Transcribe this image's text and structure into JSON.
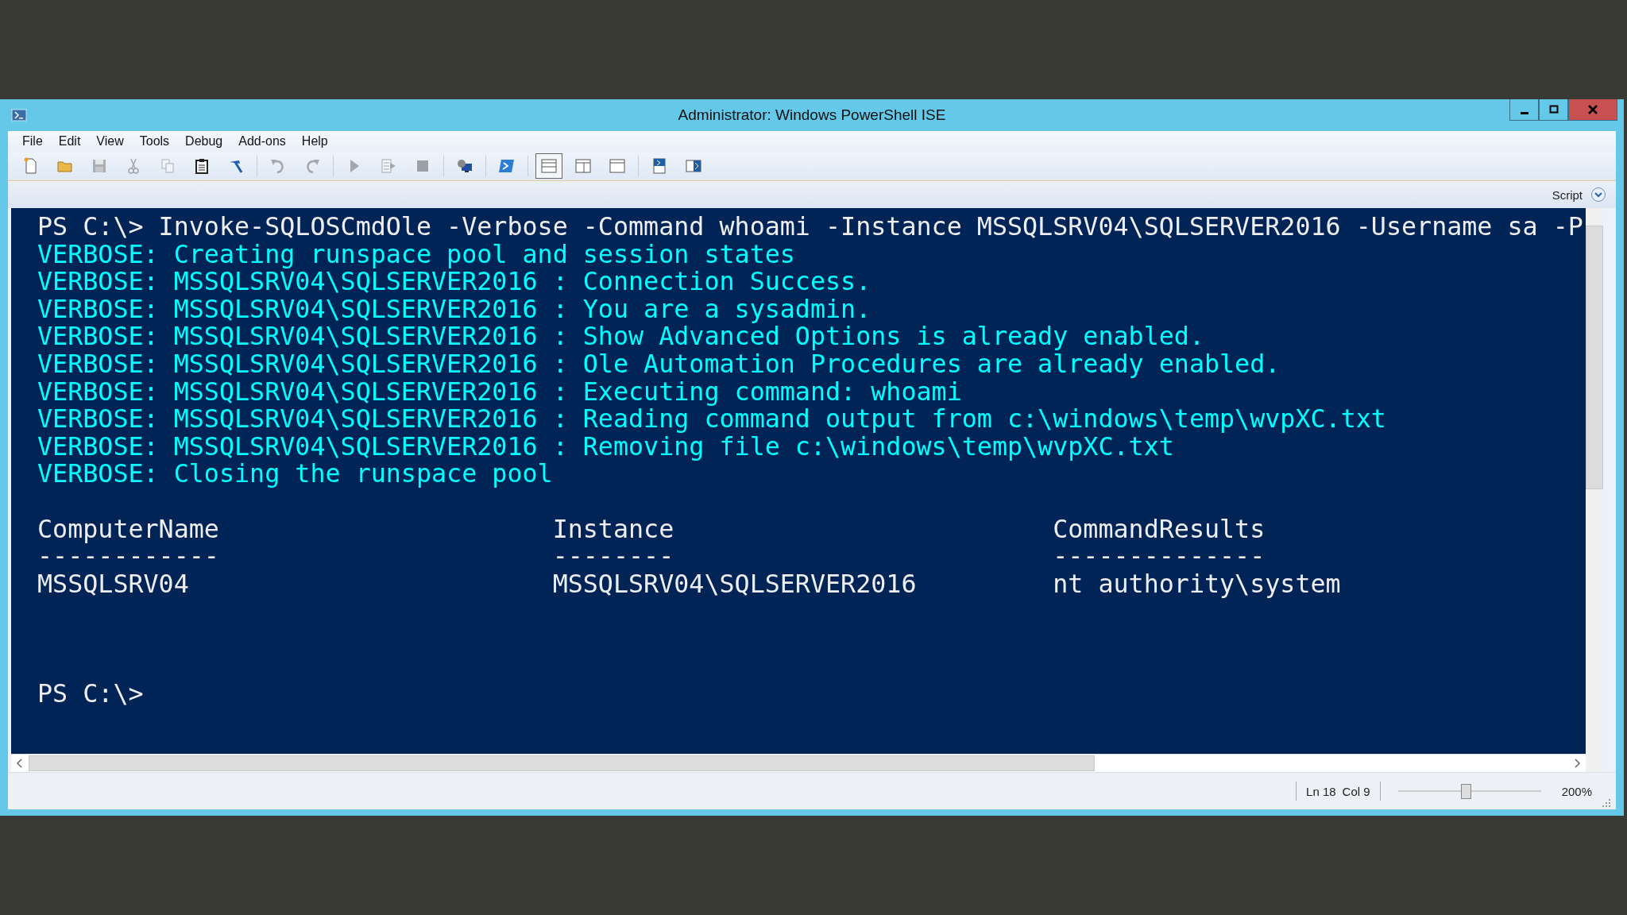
{
  "window": {
    "title": "Administrator: Windows PowerShell ISE"
  },
  "menu": [
    {
      "label": "File"
    },
    {
      "label": "Edit"
    },
    {
      "label": "View"
    },
    {
      "label": "Tools"
    },
    {
      "label": "Debug"
    },
    {
      "label": "Add-ons"
    },
    {
      "label": "Help"
    }
  ],
  "toolbar": [
    {
      "kind": "new",
      "disabled": false
    },
    {
      "kind": "open",
      "disabled": false
    },
    {
      "kind": "save",
      "disabled": true
    },
    {
      "kind": "cut",
      "disabled": true
    },
    {
      "kind": "copy",
      "disabled": true
    },
    {
      "kind": "paste",
      "disabled": false
    },
    {
      "kind": "clear",
      "disabled": false
    },
    {
      "kind": "sep"
    },
    {
      "kind": "undo",
      "disabled": true
    },
    {
      "kind": "redo",
      "disabled": true
    },
    {
      "kind": "sep"
    },
    {
      "kind": "run",
      "disabled": true
    },
    {
      "kind": "runsel",
      "disabled": true
    },
    {
      "kind": "stop",
      "disabled": true
    },
    {
      "kind": "sep"
    },
    {
      "kind": "remote",
      "disabled": false
    },
    {
      "kind": "sep"
    },
    {
      "kind": "shell",
      "disabled": false
    },
    {
      "kind": "sep"
    },
    {
      "kind": "pane-top",
      "selected": true
    },
    {
      "kind": "pane-right",
      "selected": false
    },
    {
      "kind": "pane-max",
      "selected": false
    },
    {
      "kind": "sep"
    },
    {
      "kind": "show-top",
      "disabled": false
    },
    {
      "kind": "show-right",
      "disabled": false
    }
  ],
  "script_toggle": {
    "label": "Script"
  },
  "console": {
    "lines": [
      {
        "kind": "prompt",
        "text": "PS C:\\> Invoke-SQLOSCmdOle -Verbose -Command whoami -Instance MSSQLSRV04\\SQLSERVER2016 -Username sa -P"
      },
      {
        "kind": "verbose",
        "text": "VERBOSE: Creating runspace pool and session states"
      },
      {
        "kind": "verbose",
        "text": "VERBOSE: MSSQLSRV04\\SQLSERVER2016 : Connection Success."
      },
      {
        "kind": "verbose",
        "text": "VERBOSE: MSSQLSRV04\\SQLSERVER2016 : You are a sysadmin."
      },
      {
        "kind": "verbose",
        "text": "VERBOSE: MSSQLSRV04\\SQLSERVER2016 : Show Advanced Options is already enabled."
      },
      {
        "kind": "verbose",
        "text": "VERBOSE: MSSQLSRV04\\SQLSERVER2016 : Ole Automation Procedures are already enabled."
      },
      {
        "kind": "verbose",
        "text": "VERBOSE: MSSQLSRV04\\SQLSERVER2016 : Executing command: whoami"
      },
      {
        "kind": "verbose",
        "text": "VERBOSE: MSSQLSRV04\\SQLSERVER2016 : Reading command output from c:\\windows\\temp\\wvpXC.txt"
      },
      {
        "kind": "verbose",
        "text": "VERBOSE: MSSQLSRV04\\SQLSERVER2016 : Removing file c:\\windows\\temp\\wvpXC.txt"
      },
      {
        "kind": "verbose",
        "text": "VERBOSE: Closing the runspace pool"
      }
    ],
    "table": {
      "columns": [
        {
          "header": "ComputerName",
          "rule": "------------",
          "value": "MSSQLSRV04"
        },
        {
          "header": "Instance",
          "rule": "--------",
          "value": "MSSQLSRV04\\SQLSERVER2016"
        },
        {
          "header": "CommandResults",
          "rule": "--------------",
          "value": "nt authority\\system"
        }
      ]
    },
    "prompt": "PS C:\\>"
  },
  "status_bar": {
    "position": "Ln 18",
    "column": "Col 9",
    "zoom": {
      "level": 0.47,
      "reading": "200%"
    }
  }
}
